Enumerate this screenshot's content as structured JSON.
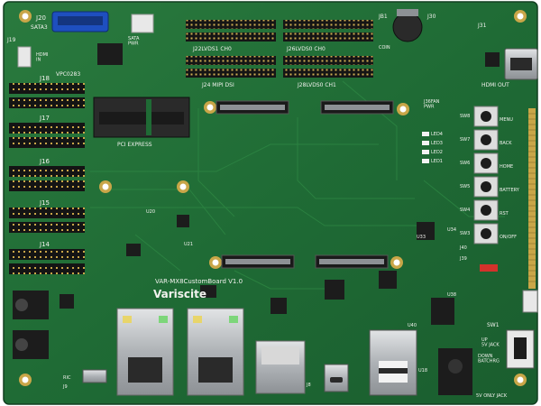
{
  "board": {
    "brand": "Variscite",
    "model": "VAR-MX8CustomBoard V1.0",
    "colors": {
      "pcb": "#1f6b35",
      "pcb_edge": "#2f8a45",
      "silkscreen": "#f2f2ee",
      "gold": "#d8b24a",
      "metal": "#b9bdc1",
      "black_part": "#1c1c1c",
      "sata_blue": "#1e4fbf",
      "led_red": "#d3322b"
    }
  },
  "labels": {
    "j20": "J20",
    "sata3": "SATA3",
    "sata_pwr": "SATA\nPWR",
    "j19": "J19",
    "hdmi_in": "HDMI\nIN",
    "vpc0283": "VPC0283",
    "j18": "J18",
    "j17": "J17",
    "j16": "J16",
    "j15": "J15",
    "j14": "J14",
    "pci_express": "PCI EXPRESS",
    "j22_lvds1_ch0": "J22LVDS1 CH0",
    "j24_mipi_dsi": "J24 MIPI DSI",
    "j26_lvds0_ch0": "J26LVDS0 CH0",
    "j28_lvds0_ch1": "J28LVDS0 CH1",
    "jb1": "JB1",
    "j30": "J30",
    "j31": "J31",
    "coin": "COIN",
    "hdmi_out": "HDMI OUT",
    "j36_fan_pwr": "J36FAN\nPWR",
    "led4": "LED4",
    "led3": "LED3",
    "led2": "LED2",
    "led1": "LED1",
    "sw8": "SW8",
    "sw7": "SW7",
    "sw6": "SW6",
    "sw5": "SW5",
    "sw4": "SW4",
    "sw3": "SW3",
    "back": "BACK",
    "home": "HOME",
    "menu": "MENU",
    "rst": "RST",
    "on_off": "ON/OFF",
    "battery": "BATTERY",
    "j40": "J40",
    "j39": "J39",
    "sw1": "SW1",
    "up_5v_jack": "UP\n5V JACK",
    "down_batchrg": "DOWN\nBATCHRG",
    "five_v_only_jack": "5V ONLY JACK",
    "u20": "U20",
    "u21": "U21",
    "u33": "U33",
    "u34": "U34",
    "u38": "U38",
    "u40": "U40",
    "u18": "U18",
    "j8": "J8",
    "ric": "RIC",
    "j9": "J9"
  }
}
